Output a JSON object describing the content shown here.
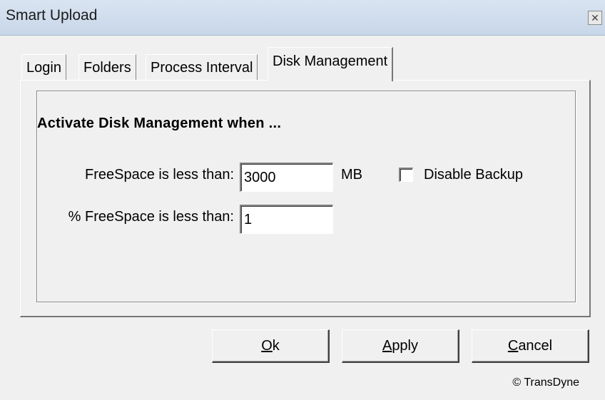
{
  "window": {
    "title": "Smart Upload",
    "close_glyph": "✕"
  },
  "tabs": [
    {
      "label": "Login"
    },
    {
      "label": "Folders"
    },
    {
      "label": "Process Interval"
    },
    {
      "label": "Disk Management",
      "active": true
    }
  ],
  "disk_management": {
    "heading": "Activate Disk Management when ...",
    "freespace_label": "FreeSpace is less than:",
    "freespace_value": "3000",
    "freespace_unit": "MB",
    "disable_backup_label": "Disable Backup",
    "disable_backup_checked": false,
    "pct_freespace_label": "% FreeSpace is less than:",
    "pct_freespace_value": "1"
  },
  "buttons": {
    "ok": {
      "accel": "O",
      "rest": "k"
    },
    "apply": {
      "accel": "A",
      "rest": "pply"
    },
    "cancel": {
      "accel": "C",
      "rest": "ancel"
    }
  },
  "footer": {
    "copyright": "© TransDyne"
  }
}
